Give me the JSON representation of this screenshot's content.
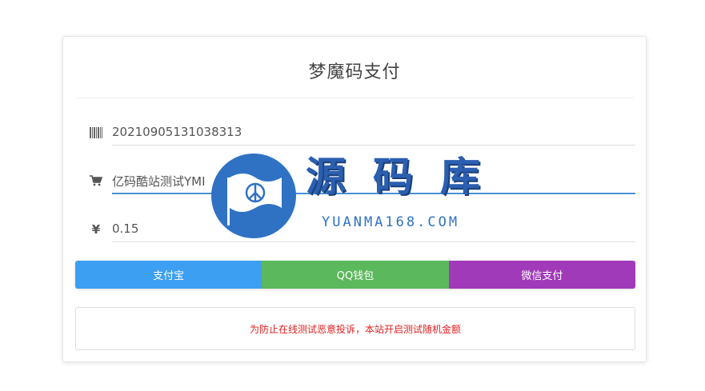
{
  "page": {
    "title": "梦魔码支付"
  },
  "fields": {
    "order_no": {
      "icon": "barcode-icon",
      "value": "20210905131038313"
    },
    "product": {
      "icon": "cart-icon",
      "value": "亿码酷站测试YMI"
    },
    "amount": {
      "icon": "yen-icon",
      "symbol": "¥",
      "value": "0.15"
    }
  },
  "payment": {
    "alipay_label": "支付宝",
    "qq_label": "QQ钱包",
    "wechat_label": "微信支付",
    "colors": {
      "alipay": "#3d9ff1",
      "qq": "#5cb85c",
      "wechat": "#a13ab9"
    }
  },
  "notice": {
    "text": "为防止在线测试恶意投诉，本站开启测试随机金额",
    "color": "#e02020"
  },
  "watermark": {
    "chars": [
      "源",
      "码",
      "库"
    ],
    "url": "YUANMA168.COM"
  }
}
